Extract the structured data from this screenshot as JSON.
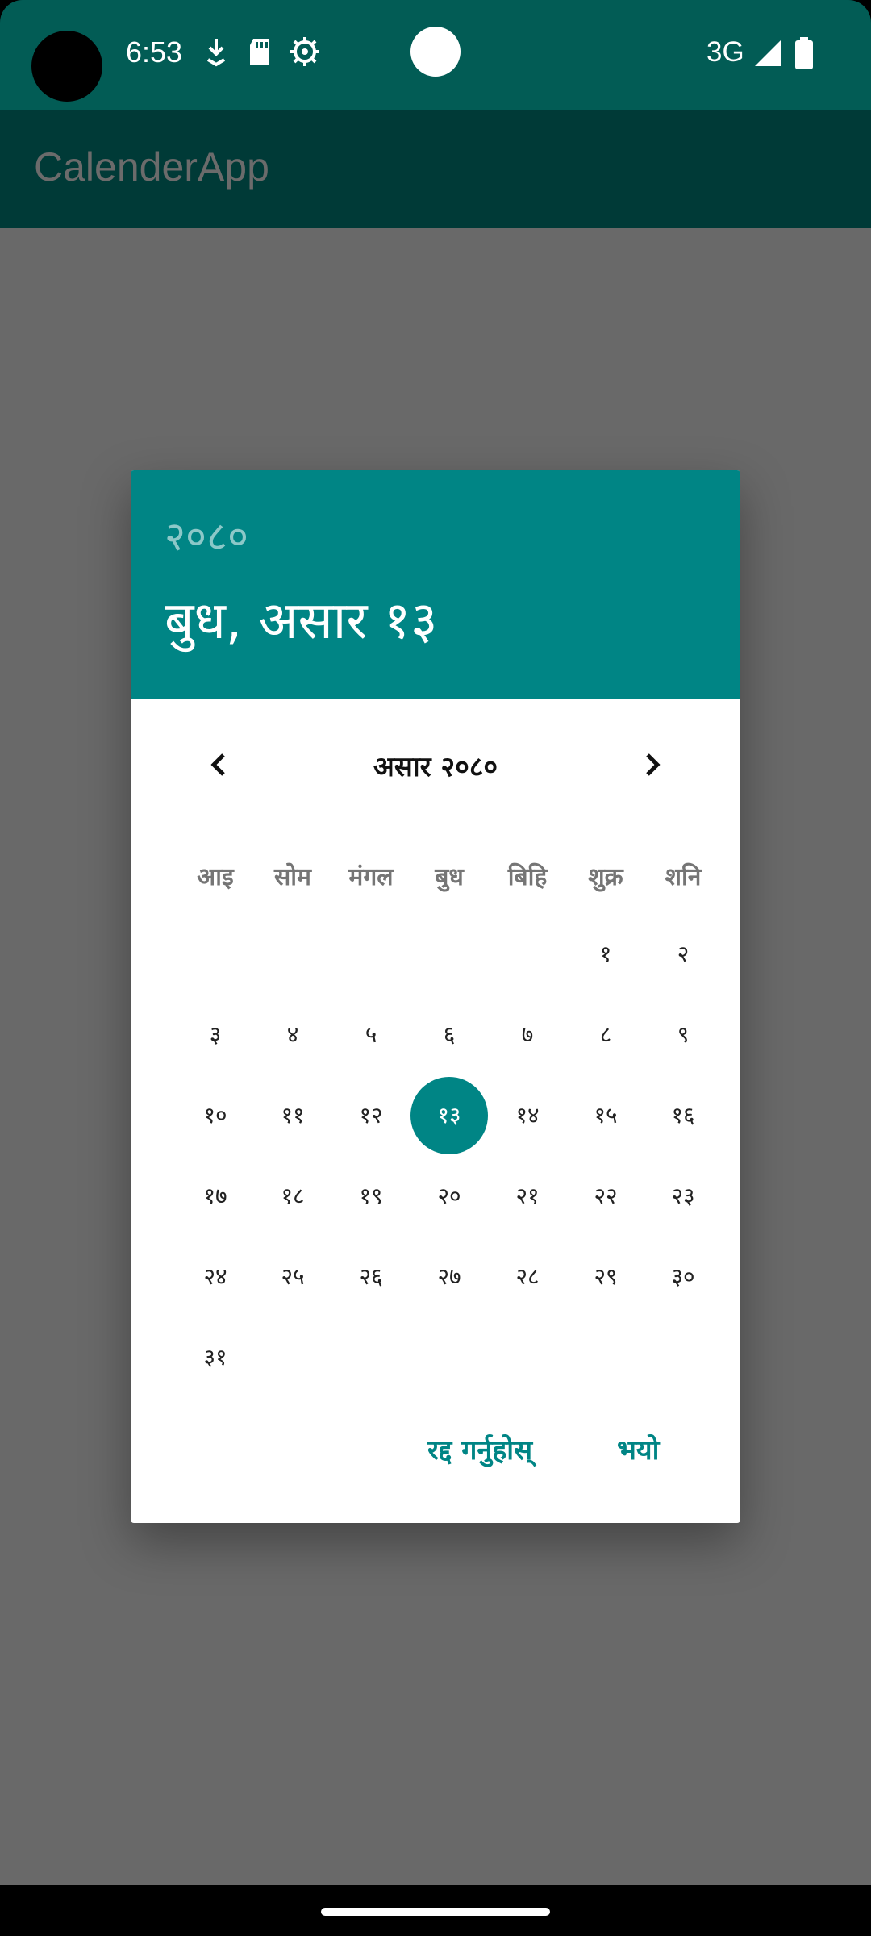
{
  "status_bar": {
    "time": "6:53",
    "network": "3G",
    "icons": [
      "download-icon",
      "sd-card-icon",
      "settings-gear-icon",
      "signal-icon",
      "battery-icon"
    ]
  },
  "app_bar": {
    "title": "CalenderApp"
  },
  "dialog": {
    "header": {
      "year": "२०८०",
      "selected_date": "बुध, असार १३"
    },
    "month_title": "असार २०८०",
    "weekdays": [
      "आइ",
      "सोम",
      "मंगल",
      "बुध",
      "बिहि",
      "शुक्र",
      "शनि"
    ],
    "days": [
      [
        "",
        "",
        "",
        "",
        "",
        "१",
        "२"
      ],
      [
        "३",
        "४",
        "५",
        "६",
        "७",
        "८",
        "९"
      ],
      [
        "१०",
        "११",
        "१२",
        "१३",
        "१४",
        "१५",
        "१६"
      ],
      [
        "१७",
        "१८",
        "१९",
        "२०",
        "२१",
        "२२",
        "२३"
      ],
      [
        "२४",
        "२५",
        "२६",
        "२७",
        "२८",
        "२९",
        "३०"
      ],
      [
        "३१",
        "",
        "",
        "",
        "",
        "",
        ""
      ]
    ],
    "selected_day": "१३",
    "buttons": {
      "cancel": "रद्द गर्नुहोस्",
      "ok": "भयो"
    }
  },
  "colors": {
    "status_bar": "#025c55",
    "app_bar": "#003a37",
    "scrim": "#696969",
    "accent": "#008585"
  }
}
